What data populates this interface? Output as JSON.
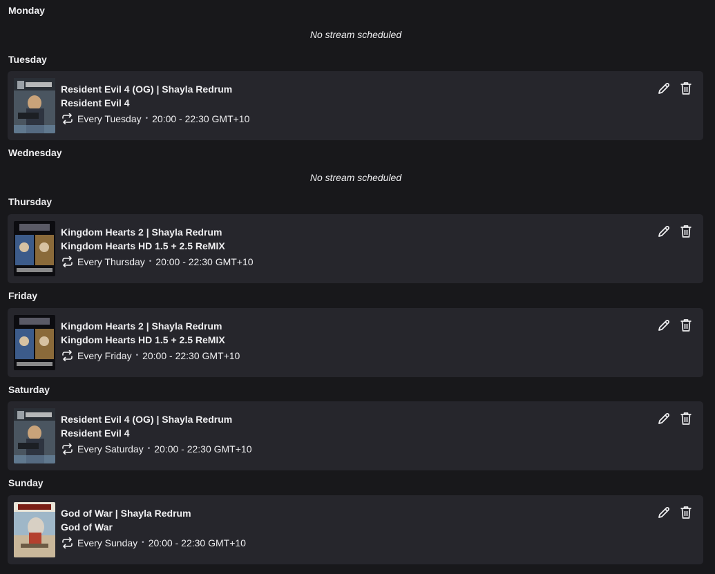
{
  "days": [
    {
      "label": "Monday",
      "empty_text": "No stream scheduled"
    },
    {
      "label": "Tuesday",
      "stream": {
        "title": "Resident Evil 4 (OG) | Shayla Redrum",
        "game": "Resident Evil 4",
        "repeat": "Every Tuesday",
        "time": "20:00 - 22:30 GMT+10",
        "art": "resident-evil-4-cover"
      }
    },
    {
      "label": "Wednesday",
      "empty_text": "No stream scheduled"
    },
    {
      "label": "Thursday",
      "stream": {
        "title": "Kingdom Hearts 2 | Shayla Redrum",
        "game": "Kingdom Hearts HD 1.5 + 2.5 ReMIX",
        "repeat": "Every Thursday",
        "time": "20:00 - 22:30 GMT+10",
        "art": "kingdom-hearts-cover"
      }
    },
    {
      "label": "Friday",
      "stream": {
        "title": "Kingdom Hearts 2 | Shayla Redrum",
        "game": "Kingdom Hearts HD 1.5 + 2.5 ReMIX",
        "repeat": "Every Friday",
        "time": "20:00 - 22:30 GMT+10",
        "art": "kingdom-hearts-cover"
      }
    },
    {
      "label": "Saturday",
      "stream": {
        "title": "Resident Evil 4 (OG) | Shayla Redrum",
        "game": "Resident Evil 4",
        "repeat": "Every Saturday",
        "time": "20:00 - 22:30 GMT+10",
        "art": "resident-evil-4-cover"
      }
    },
    {
      "label": "Sunday",
      "stream": {
        "title": "God of War | Shayla Redrum",
        "game": "God of War",
        "repeat": "Every Sunday",
        "time": "20:00 - 22:30 GMT+10",
        "art": "god-of-war-cover"
      }
    }
  ],
  "icons": {
    "edit": "pencil-icon",
    "delete": "trash-icon",
    "repeat": "repeat-icon"
  },
  "colors": {
    "background": "#18181b",
    "card": "#26262c",
    "text": "#efeff1"
  }
}
